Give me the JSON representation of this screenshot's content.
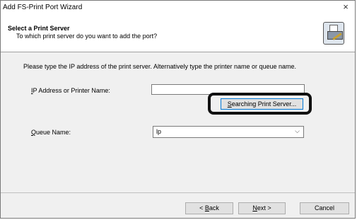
{
  "window": {
    "title": "Add FS-Print Port Wizard",
    "close_glyph": "×"
  },
  "header": {
    "title": "Select a Print Server",
    "subtitle": "To which print server do you want to add the port?",
    "icon": "print-wizard-icon"
  },
  "body": {
    "instruction": "Please type the IP address of the print server. Alternatively type the printer name or queue name.",
    "ip_label_mnemonic": "I",
    "ip_label_rest": "P Address or Printer Name:",
    "ip_value": "",
    "search_button_mnemonic": "S",
    "search_button_rest": "earching Print Server...",
    "queue_label_mnemonic": "Q",
    "queue_label_rest": "ueue Name:",
    "queue_value": "lp",
    "chevron_glyph": "⌵"
  },
  "footer": {
    "back_prefix": "< ",
    "back_mnemonic": "B",
    "back_rest": "ack",
    "next_mnemonic": "N",
    "next_rest": "ext >",
    "cancel_label": "Cancel"
  },
  "colors": {
    "dialog_bg": "#f0f0f0",
    "header_bg": "#ffffff",
    "focus_border": "#0078d7",
    "highlight": "#111111"
  }
}
